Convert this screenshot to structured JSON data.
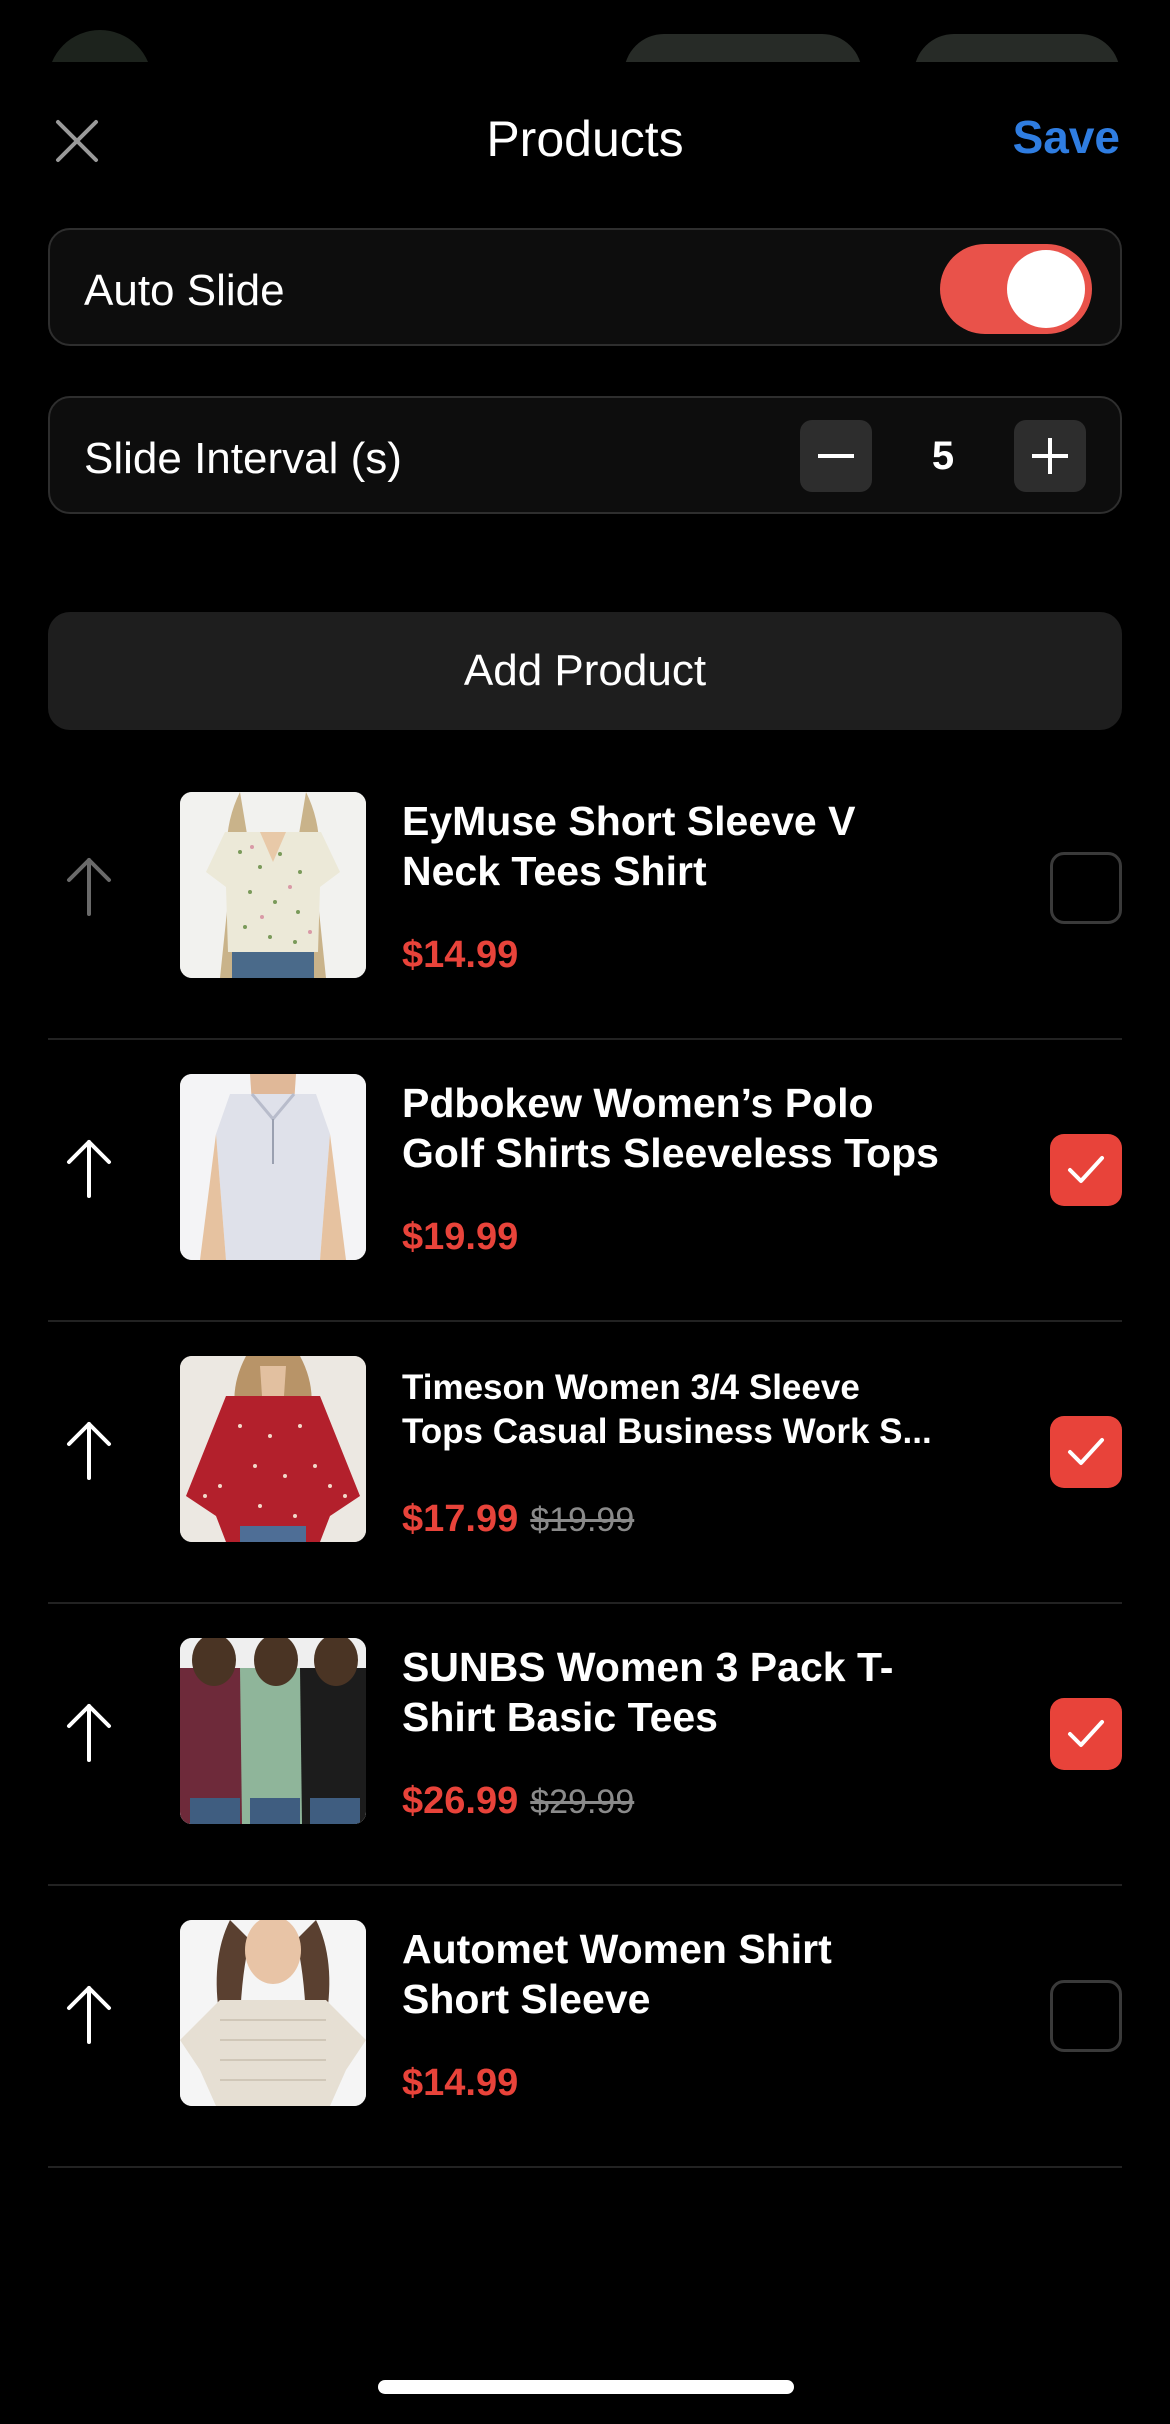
{
  "header": {
    "title": "Products",
    "save_label": "Save",
    "close_icon": "close-icon"
  },
  "settings": {
    "auto_slide_label": "Auto Slide",
    "auto_slide_on": true,
    "interval_label": "Slide Interval (s)",
    "interval_value": "5"
  },
  "add_product_label": "Add Product",
  "colors": {
    "accent_red": "#e8433a",
    "save_blue": "#2f7de1",
    "toggle_on": "#e9524a"
  },
  "products": [
    {
      "name_line1": "EyMuse Short Sleeve V",
      "name_line2": "Neck Tees Shirt",
      "price": "$14.99",
      "original_price": "",
      "checked": false,
      "arrow_enabled": false
    },
    {
      "name_line1": "Pdbokew Women’s Polo",
      "name_line2": "Golf Shirts Sleeveless Tops",
      "price": "$19.99",
      "original_price": "",
      "checked": true,
      "arrow_enabled": true
    },
    {
      "name_line1": "Timeson Women 3/4 Sleeve",
      "name_line2": "Tops Casual Business Work S...",
      "price": "$17.99",
      "original_price": "$19.99",
      "checked": true,
      "arrow_enabled": true
    },
    {
      "name_line1": "SUNBS Women 3 Pack T-",
      "name_line2": "Shirt Basic Tees",
      "price": "$26.99",
      "original_price": "$29.99",
      "checked": true,
      "arrow_enabled": true
    },
    {
      "name_line1": "Automet Women Shirt",
      "name_line2": "Short Sleeve",
      "price": "$14.99",
      "original_price": "",
      "checked": false,
      "arrow_enabled": true
    }
  ]
}
